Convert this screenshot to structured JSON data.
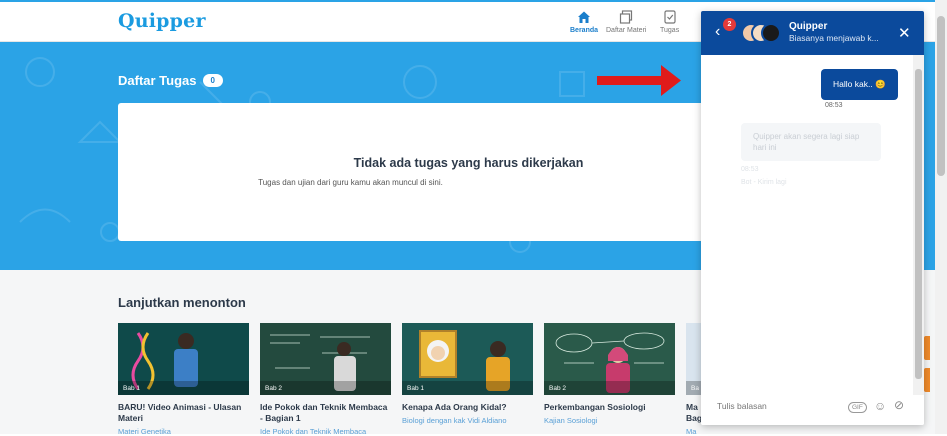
{
  "brand": {
    "logo": "Quipper"
  },
  "nav": [
    {
      "label": "Beranda",
      "icon": "home-icon",
      "active": true
    },
    {
      "label": "Daftar Materi",
      "icon": "materials-icon",
      "active": false
    },
    {
      "label": "Tugas",
      "icon": "tasks-icon",
      "active": false
    }
  ],
  "tasks": {
    "title": "Daftar Tugas",
    "count": "0",
    "empty_title": "Tidak ada tugas yang harus dikerjakan",
    "empty_subtitle": "Tugas dan ujian dari guru kamu akan muncul di sini."
  },
  "continue": {
    "title": "Lanjutkan menonton",
    "videos": [
      {
        "bab": "Bab 1",
        "title": "BARU! Video Animasi - Ulasan Materi",
        "subtitle": "Materi Genetika"
      },
      {
        "bab": "Bab 2",
        "title": "Ide Pokok dan Teknik Membaca - Bagian 1",
        "subtitle": "Ide Pokok dan Teknik Membaca"
      },
      {
        "bab": "Bab 1",
        "title": "Kenapa Ada Orang Kidal?",
        "subtitle": "Biologi dengan kak Vidi Aldiano"
      },
      {
        "bab": "Bab 2",
        "title": "Perkembangan Sosiologi",
        "subtitle": "Kajian Sosiologi"
      },
      {
        "bab": "Ba",
        "title": "Ma Bag",
        "subtitle": "Ma"
      }
    ]
  },
  "chat": {
    "unread": "2",
    "name": "Quipper",
    "status": "Biasanya menjawab k...",
    "messages": [
      {
        "from": "user",
        "text": "Hallo kak.. 😊",
        "time": "08:53"
      },
      {
        "from": "agent",
        "text": "Quipper akan segera lagi siap hari ini",
        "meta1": "08:53",
        "meta2": "Bot - Kirim lagi"
      }
    ],
    "reply_placeholder": "Tulis balasan",
    "gif_label": "GIF"
  },
  "colors": {
    "brand_blue": "#2ba3e6",
    "chat_header": "#0b4a9c",
    "alert_arrow": "#e01b1b",
    "badge_red": "#e33a3a"
  }
}
